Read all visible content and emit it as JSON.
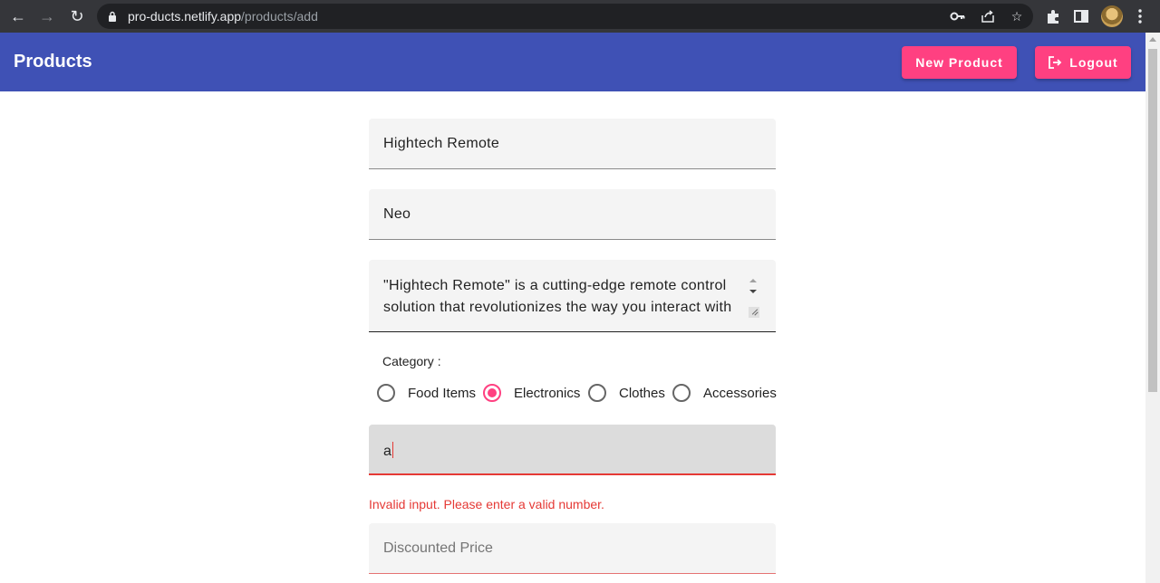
{
  "browser": {
    "url_host": "pro-ducts.netlify.app",
    "url_path": "/products/add"
  },
  "appbar": {
    "title": "Products",
    "new_product_label": "New Product",
    "logout_label": "Logout",
    "accent_color": "#ff4081",
    "bar_color": "#3f51b5"
  },
  "form": {
    "name_value": "Hightech Remote",
    "brand_value": "Neo",
    "description_value": "\"Hightech Remote\" is a cutting-edge remote control solution that revolutionizes the way you interact with",
    "category_label": "Category :",
    "categories": [
      {
        "label": "Food Items",
        "checked": false
      },
      {
        "label": "Electronics",
        "checked": true
      },
      {
        "label": "Clothes",
        "checked": false
      },
      {
        "label": "Accessories",
        "checked": false
      }
    ],
    "price_value": "a",
    "price_error": "Invalid input. Please enter a valid number.",
    "discounted_price_placeholder": "Discounted Price",
    "error_color": "#e53935"
  }
}
